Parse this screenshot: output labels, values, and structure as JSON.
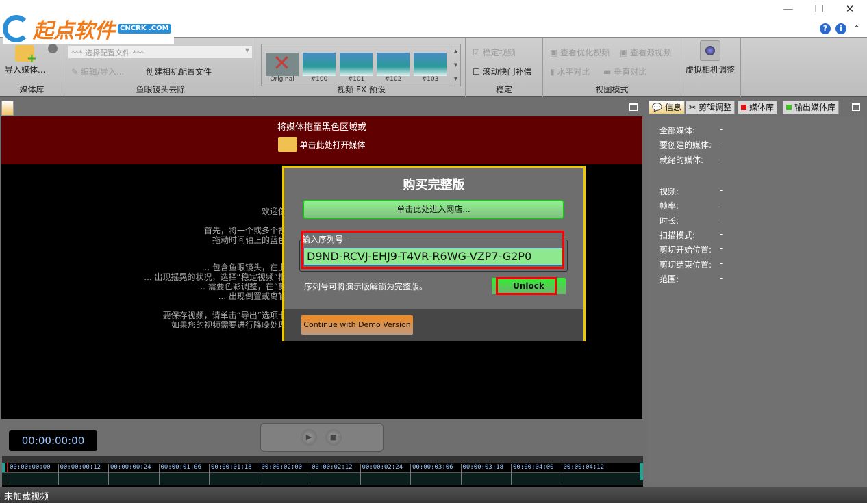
{
  "logo": {
    "text": "起点软件",
    "sub": "CNCRK .COM"
  },
  "window": {
    "minimize": "—",
    "maximize": "☐",
    "close": "✕",
    "help": "?",
    "info": "i",
    "collapse": "⌃"
  },
  "ribbon": {
    "media": {
      "import": "导入媒体...",
      "label": "媒体库"
    },
    "fisheye": {
      "profile_placeholder": "*** 选择配置文件 ***",
      "edit": "编辑/导入...",
      "create": "创建相机配置文件",
      "label": "鱼眼镜头去除"
    },
    "fx": {
      "presets": [
        "Original",
        "#100",
        "#101",
        "#102",
        "#103"
      ],
      "label": "视频 FX 预设"
    },
    "stabilize": {
      "stabilize_video": "稳定视频",
      "stabilize_checked": true,
      "rolling_shutter": "滚动快门补偿",
      "rolling_checked": false,
      "label": "稳定"
    },
    "view": {
      "optimized": "查看优化视频",
      "source": "查看源视频",
      "horizontal": "水平对比",
      "vertical": "垂直对比",
      "label": "视图模式"
    },
    "camera": {
      "label": "虚拟相机调整"
    }
  },
  "drop": {
    "line1": "将媒体拖至黑色区域或",
    "open": "单击此处打开媒体"
  },
  "welcome": [
    "欢迎使",
    "首先，将一个或多个视",
    "拖动时间轴上的蓝色",
    "... 包含鱼眼镜头，在上",
    "... 出现摇晃的状况，选择“稳定视频”框",
    "... 需要色彩调整，在“剪",
    "... 出现倒置或离轴",
    "要保存视频，请单击“导出”选项卡",
    "如果您的视频需要进行降噪处理"
  ],
  "dialog": {
    "title": "购买完整版",
    "store": "单击此处进入网店...",
    "serial_label": "输入序列号",
    "serial_value": "D9ND-RCVJ-EHJ9-T4VR-R6WG-VZP7-G2P0",
    "hint": "序列号可将演示版解锁为完整版。",
    "unlock": "Unlock",
    "demo": "Continue with Demo Version"
  },
  "player": {
    "timecode": "00:00:00:00"
  },
  "timeline": {
    "ticks": [
      "00:00:00;00",
      "00:00:00;12",
      "00:00:00;24",
      "00:00:01;06",
      "00:00:01;18",
      "00:00:02;00",
      "00:00:02;12",
      "00:00:02;24",
      "00:00:03;06",
      "00:00:03;18",
      "00:00:04;00",
      "00:00:04;12"
    ]
  },
  "right_tabs": [
    {
      "label": "信息",
      "active": true
    },
    {
      "label": "剪辑调整"
    },
    {
      "label": "媒体库",
      "color": "#e01010"
    },
    {
      "label": "输出媒体库",
      "color": "#40c020"
    }
  ],
  "info": {
    "group1": [
      {
        "label": "全部媒体:",
        "value": "-"
      },
      {
        "label": "要创建的媒体:",
        "value": "-"
      },
      {
        "label": "就绪的媒体:",
        "value": "-"
      }
    ],
    "group2": [
      {
        "label": "视频:",
        "value": "-"
      },
      {
        "label": "帧率:",
        "value": "-"
      },
      {
        "label": "时长:",
        "value": "-"
      },
      {
        "label": "扫描模式:",
        "value": "-"
      },
      {
        "label": "剪切开始位置:",
        "value": "-"
      },
      {
        "label": "剪切结束位置:",
        "value": "-"
      },
      {
        "label": "范围:",
        "value": "-"
      }
    ]
  },
  "status": "未加载视频"
}
